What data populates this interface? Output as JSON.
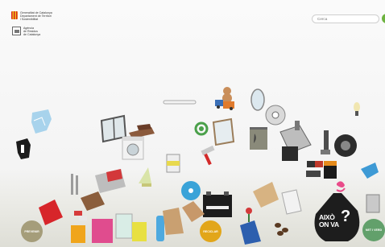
{
  "header": {
    "gencat_lines": [
      "Generalitat de Catalunya",
      "Departament de Territori",
      "i Sostenibilitat"
    ],
    "agency_lines": [
      "Agència",
      "de Residus",
      "de Catalunya"
    ]
  },
  "search": {
    "placeholder": "Cerca"
  },
  "buttons": {
    "left_label": "PREVENIR",
    "middle_label": "RECICLAR",
    "right_label": "NET I VERD"
  },
  "sign": {
    "text_line1": "AIXÒ",
    "text_line2": "ON VA",
    "mark": "?"
  },
  "colors": {
    "accent_green": "#6db33f",
    "sign_black": "#1d1d1d",
    "bag_pink": "#e94b8a"
  }
}
